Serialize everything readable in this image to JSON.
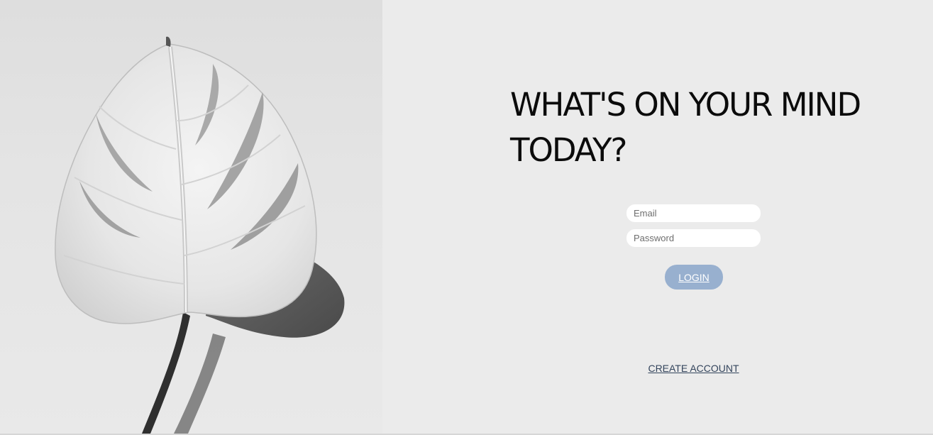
{
  "hero": {
    "image_icon": "monstera-leaf-photo"
  },
  "headline": {
    "line1": "WHAT'S ON YOUR MIND",
    "line2": "TODAY?"
  },
  "login_form": {
    "email_placeholder": "Email",
    "email_value": "",
    "password_placeholder": "Password",
    "password_value": "",
    "login_label": "LOGIN",
    "create_account_label": "CREATE ACCOUNT"
  },
  "colors": {
    "background": "#ebebeb",
    "login_button": "#98b0cf",
    "link": "#33445c",
    "headline": "#0b0b0b"
  }
}
